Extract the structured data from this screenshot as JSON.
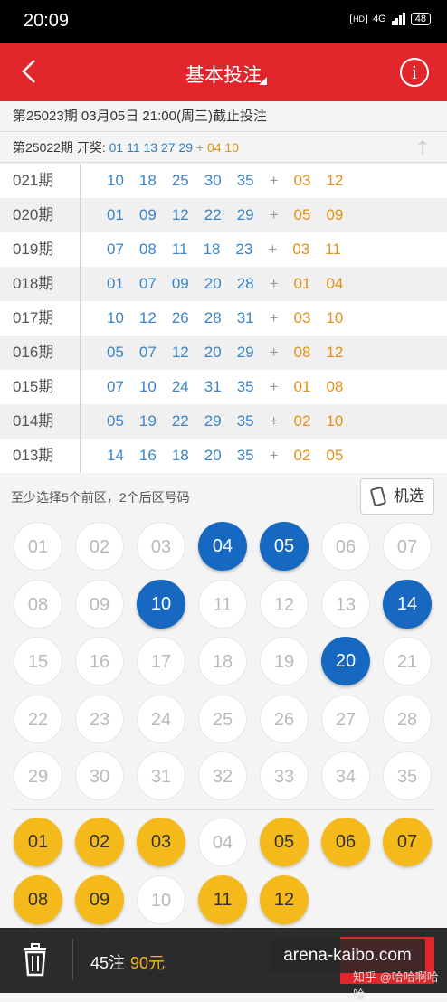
{
  "status": {
    "time": "20:09",
    "network": "4G",
    "battery": "48"
  },
  "nav": {
    "title": "基本投注"
  },
  "deadline": "第25023期 03月05日 21:00(周三)截止投注",
  "last_draw": {
    "label": "第25022期 开奖:",
    "front": [
      "01",
      "11",
      "13",
      "27",
      "29"
    ],
    "plus": "+",
    "back": [
      "04",
      "10"
    ]
  },
  "history": [
    {
      "period": "021期",
      "front": [
        "10",
        "18",
        "25",
        "30",
        "35"
      ],
      "back": [
        "03",
        "12"
      ]
    },
    {
      "period": "020期",
      "front": [
        "01",
        "09",
        "12",
        "22",
        "29"
      ],
      "back": [
        "05",
        "09"
      ]
    },
    {
      "period": "019期",
      "front": [
        "07",
        "08",
        "11",
        "18",
        "23"
      ],
      "back": [
        "03",
        "11"
      ]
    },
    {
      "period": "018期",
      "front": [
        "01",
        "07",
        "09",
        "20",
        "28"
      ],
      "back": [
        "01",
        "04"
      ]
    },
    {
      "period": "017期",
      "front": [
        "10",
        "12",
        "26",
        "28",
        "31"
      ],
      "back": [
        "03",
        "10"
      ]
    },
    {
      "period": "016期",
      "front": [
        "05",
        "07",
        "12",
        "20",
        "29"
      ],
      "back": [
        "08",
        "12"
      ]
    },
    {
      "period": "015期",
      "front": [
        "07",
        "10",
        "24",
        "31",
        "35"
      ],
      "back": [
        "01",
        "08"
      ]
    },
    {
      "period": "014期",
      "front": [
        "05",
        "19",
        "22",
        "29",
        "35"
      ],
      "back": [
        "02",
        "10"
      ]
    },
    {
      "period": "013期",
      "front": [
        "14",
        "16",
        "18",
        "20",
        "35"
      ],
      "back": [
        "02",
        "05"
      ]
    }
  ],
  "hint": "至少选择5个前区，2个后区号码",
  "random_label": "机选",
  "front_numbers": [
    "01",
    "02",
    "03",
    "04",
    "05",
    "06",
    "07",
    "08",
    "09",
    "10",
    "11",
    "12",
    "13",
    "14",
    "15",
    "16",
    "17",
    "18",
    "19",
    "20",
    "21",
    "22",
    "23",
    "24",
    "25",
    "26",
    "27",
    "28",
    "29",
    "30",
    "31",
    "32",
    "33",
    "34",
    "35"
  ],
  "front_selected": [
    "04",
    "05",
    "10",
    "14",
    "20"
  ],
  "back_numbers": [
    "01",
    "02",
    "03",
    "04",
    "05",
    "06",
    "07",
    "08",
    "09",
    "10",
    "11",
    "12"
  ],
  "back_selected": [
    "01",
    "02",
    "03",
    "05",
    "06",
    "07",
    "08",
    "09",
    "11",
    "12"
  ],
  "summary": {
    "count": "45注",
    "amount": "90元"
  },
  "watermark": "arena-kaibo.com",
  "credit": "知乎 @哈哈啊哈哈",
  "colors": {
    "brand_red": "#e1262b",
    "front_blue": "#1668c0",
    "back_gold": "#f4b91a",
    "history_blue": "#3a84c8",
    "history_orange": "#e39017"
  }
}
